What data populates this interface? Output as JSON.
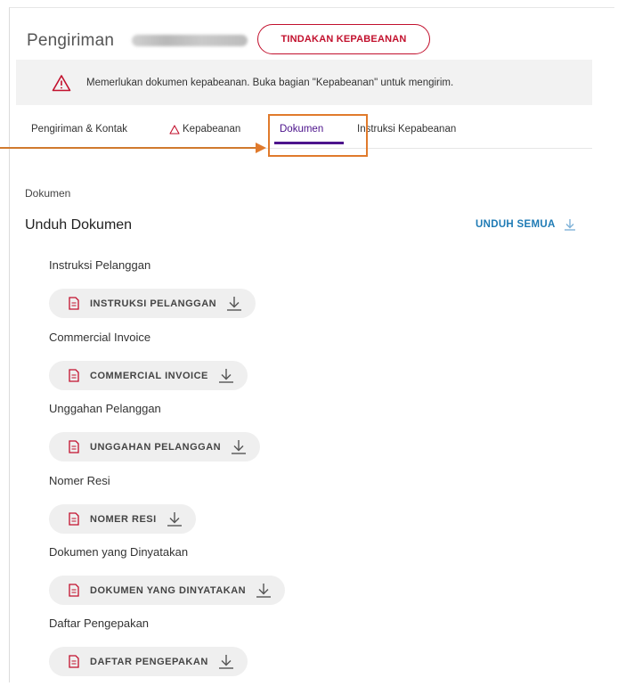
{
  "header": {
    "title": "Pengiriman",
    "customs_action_label": "TINDAKAN KEPABEANAN"
  },
  "alert": {
    "message": "Memerlukan dokumen kepabeanan. Buka bagian \"Kepabeanan\" untuk mengirim."
  },
  "tabs": [
    {
      "label": "Pengiriman & Kontak"
    },
    {
      "label": "Kepabeanan"
    },
    {
      "label": "Dokumen"
    },
    {
      "label": "Instruksi Kepabeanan"
    }
  ],
  "documents": {
    "section_label": "Dokumen",
    "title": "Unduh Dokumen",
    "download_all_label": "UNDUH SEMUA",
    "items": [
      {
        "label": "Instruksi Pelanggan",
        "button": "INSTRUKSI PELANGGAN"
      },
      {
        "label": "Commercial Invoice",
        "button": "COMMERCIAL INVOICE"
      },
      {
        "label": "Unggahan Pelanggan",
        "button": "UNGGAHAN PELANGGAN"
      },
      {
        "label": "Nomer Resi",
        "button": "NOMER RESI"
      },
      {
        "label": "Dokumen yang Dinyatakan",
        "button": "DOKUMEN YANG DINYATAKAN"
      },
      {
        "label": "Daftar Pengepakan",
        "button": "DAFTAR PENGEPAKAN"
      }
    ]
  },
  "colors": {
    "brand_red": "#c2102d",
    "active_tab": "#4d148c",
    "link_blue": "#1f7bb5",
    "annotation_orange": "#e07a2c"
  }
}
